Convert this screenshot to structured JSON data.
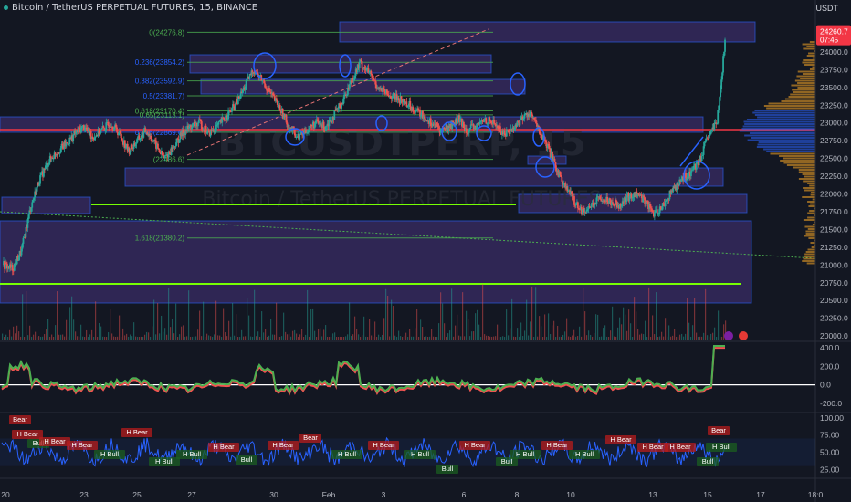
{
  "header": {
    "title": "Bitcoin / TetherUS PERPETUAL FUTURES, 15, BINANCE",
    "currency": "USDT"
  },
  "watermark": {
    "symbol": "BTCUSDTPERP, 15",
    "name": "Bitcoin / TetherUS PERPETUAL FUTURES"
  },
  "colors": {
    "background": "#131722",
    "up": "#26a69a",
    "down": "#ef5350",
    "zone": "#7b4fd6",
    "fib": "#4caf50",
    "fib_label_blue": "#2962ff",
    "rsi": "#2962ff",
    "price_tag": "#f23645"
  },
  "chart_data": [
    {
      "type": "line",
      "name": "price",
      "x_ticks": [
        "20",
        "23",
        "25",
        "27",
        "30",
        "Feb",
        "3",
        "6",
        "8",
        "10",
        "13",
        "15",
        "17",
        "18:0"
      ],
      "y_ticks": [
        "24000.0",
        "23750.0",
        "23500.0",
        "23250.0",
        "23000.0",
        "22750.0",
        "22500.0",
        "22250.0",
        "22000.0",
        "21750.0",
        "21500.0",
        "21250.0",
        "21000.0",
        "20750.0",
        "20500.0",
        "20250.0",
        "20000.0"
      ],
      "ylim": [
        19950,
        24500
      ],
      "last_price": "24260.7",
      "countdown": "07:45",
      "series_points": [
        [
          0,
          21000
        ],
        [
          2,
          20950
        ],
        [
          4,
          21200
        ],
        [
          6,
          21800
        ],
        [
          8,
          22200
        ],
        [
          10,
          22450
        ],
        [
          12,
          22600
        ],
        [
          14,
          22700
        ],
        [
          16,
          22850
        ],
        [
          18,
          22950
        ],
        [
          20,
          22800
        ],
        [
          22,
          22900
        ],
        [
          24,
          23000
        ],
        [
          26,
          22850
        ],
        [
          28,
          22600
        ],
        [
          30,
          22750
        ],
        [
          32,
          22900
        ],
        [
          34,
          22700
        ],
        [
          36,
          22500
        ],
        [
          38,
          22650
        ],
        [
          40,
          22850
        ],
        [
          42,
          22950
        ],
        [
          44,
          23000
        ],
        [
          46,
          22850
        ],
        [
          48,
          22950
        ],
        [
          50,
          23100
        ],
        [
          52,
          23250
        ],
        [
          54,
          23500
        ],
        [
          56,
          23750
        ],
        [
          58,
          23600
        ],
        [
          60,
          23400
        ],
        [
          62,
          23200
        ],
        [
          64,
          22950
        ],
        [
          66,
          22800
        ],
        [
          68,
          22900
        ],
        [
          70,
          23000
        ],
        [
          72,
          22950
        ],
        [
          74,
          23100
        ],
        [
          76,
          23300
        ],
        [
          78,
          23600
        ],
        [
          80,
          23850
        ],
        [
          82,
          23700
        ],
        [
          84,
          23500
        ],
        [
          86,
          23400
        ],
        [
          88,
          23350
        ],
        [
          90,
          23300
        ],
        [
          92,
          23200
        ],
        [
          94,
          23100
        ],
        [
          96,
          23000
        ],
        [
          98,
          22900
        ],
        [
          100,
          22950
        ],
        [
          102,
          23050
        ],
        [
          104,
          22900
        ],
        [
          106,
          22950
        ],
        [
          108,
          23050
        ],
        [
          110,
          23000
        ],
        [
          112,
          22850
        ],
        [
          114,
          22900
        ],
        [
          116,
          23050
        ],
        [
          118,
          23150
        ],
        [
          120,
          22900
        ],
        [
          122,
          22650
        ],
        [
          124,
          22350
        ],
        [
          126,
          22100
        ],
        [
          128,
          21900
        ],
        [
          130,
          21750
        ],
        [
          132,
          21850
        ],
        [
          134,
          21950
        ],
        [
          136,
          21900
        ],
        [
          138,
          21850
        ],
        [
          140,
          21950
        ],
        [
          142,
          22000
        ],
        [
          144,
          21900
        ],
        [
          146,
          21700
        ],
        [
          148,
          21850
        ],
        [
          150,
          22050
        ],
        [
          152,
          22200
        ],
        [
          154,
          22300
        ],
        [
          156,
          22450
        ],
        [
          158,
          22800
        ],
        [
          160,
          23000
        ],
        [
          162,
          24276
        ]
      ],
      "levels": [
        {
          "label": "0(24276.8)",
          "price": 24276.8
        },
        {
          "label": "0.236(23854.2)",
          "price": 23854.2
        },
        {
          "label": "0.382(23592.9)",
          "price": 23592.9
        },
        {
          "label": "0.5(23381.7)",
          "price": 23381.7
        },
        {
          "label": "0.618(23170.4)",
          "price": 23170.4
        },
        {
          "label": "0.65(23113.1)",
          "price": 23113.1
        },
        {
          "label": "0.786(22869.6)",
          "price": 22869.6
        },
        {
          "label": "(22486.6)",
          "price": 22486.6
        },
        {
          "label": "1.618(21380.2)",
          "price": 21380.2
        }
      ]
    },
    {
      "type": "line",
      "name": "oscillator",
      "y_ticks": [
        "400.0",
        "200.0",
        "0.0",
        "-200.0"
      ],
      "ylim": [
        -300,
        450
      ]
    },
    {
      "type": "line",
      "name": "rsi",
      "y_ticks": [
        "100.00",
        "75.00",
        "50.00",
        "25.00"
      ],
      "ylim": [
        15,
        105
      ],
      "signals": [
        "Bear",
        "H Bear",
        "H Bull",
        "Bull"
      ]
    }
  ]
}
